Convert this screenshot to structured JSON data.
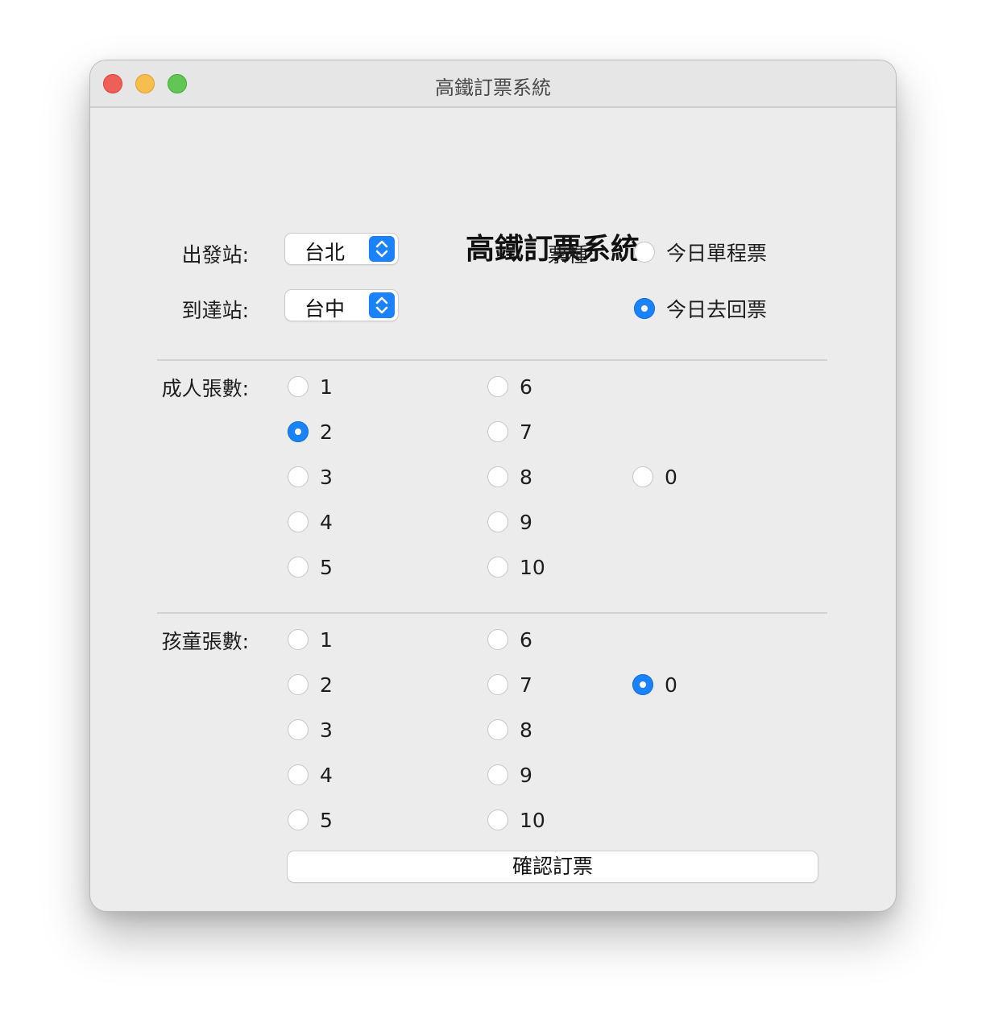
{
  "window": {
    "title": "高鐵訂票系統"
  },
  "form": {
    "heading": "高鐵訂票系統",
    "departure": {
      "label": "出發站:",
      "value": "台北"
    },
    "arrival": {
      "label": "到達站:",
      "value": "台中"
    },
    "ticket_type": {
      "label": "票種:",
      "options": [
        "今日單程票",
        "今日去回票"
      ],
      "selected": "今日去回票"
    },
    "adult": {
      "label": "成人張數:",
      "options": [
        "1",
        "2",
        "3",
        "4",
        "5",
        "6",
        "7",
        "8",
        "9",
        "10",
        "0"
      ],
      "selected": "2"
    },
    "child": {
      "label": "孩童張數:",
      "options": [
        "1",
        "2",
        "3",
        "4",
        "5",
        "6",
        "7",
        "8",
        "9",
        "10",
        "0"
      ],
      "selected": "0"
    },
    "confirm_label": "確認訂票"
  },
  "colors": {
    "accent": "#1a82fb",
    "background": "#ececec"
  },
  "icons": [
    "close-light",
    "minimize-light",
    "zoom-light",
    "chevron-up-down-icon"
  ]
}
